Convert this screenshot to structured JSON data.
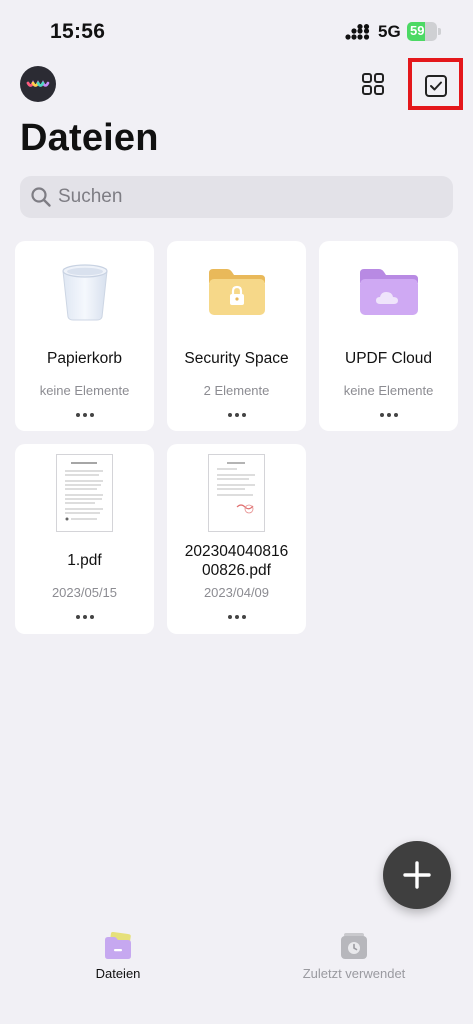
{
  "status_bar": {
    "time": "15:56",
    "network": "5G",
    "battery_percent": "59",
    "battery_level": 0.59
  },
  "header": {
    "title": "Dateien",
    "select_button_highlight_color": "#e4171b"
  },
  "search": {
    "placeholder": "Suchen"
  },
  "folders": [
    {
      "name": "Papierkorb",
      "meta": "keine Elemente",
      "icon": "trash-bin-icon"
    },
    {
      "name": "Security Space",
      "meta": "2 Elemente",
      "icon": "locked-folder-icon"
    },
    {
      "name": "UPDF Cloud",
      "meta": "keine Elemente",
      "icon": "cloud-folder-icon"
    }
  ],
  "files": [
    {
      "name": "1.pdf",
      "date": "2023/05/15",
      "icon": "pdf-thumbnail-icon"
    },
    {
      "name_line1": "202304040816",
      "name_line2": "00826.pdf",
      "date": "2023/04/09",
      "icon": "pdf-thumbnail-icon"
    }
  ],
  "tab_bar": {
    "tabs": [
      {
        "label": "Dateien",
        "icon": "folder-tab-icon",
        "active": true
      },
      {
        "label": "Zuletzt verwendet",
        "icon": "recent-clock-icon",
        "active": false
      }
    ]
  },
  "colors": {
    "background": "#f1f0f5",
    "accent_purple": "#c6a8f0",
    "folder_yellow": "#f3d47e",
    "fab": "#3f3f3f"
  }
}
